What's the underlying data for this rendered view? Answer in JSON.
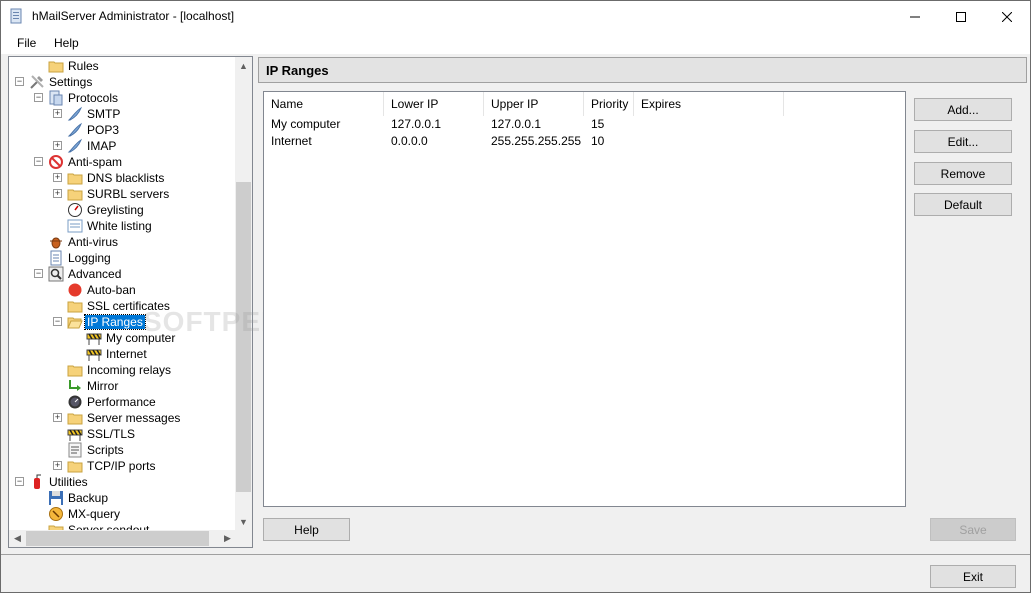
{
  "window": {
    "title": "hMailServer Administrator - [localhost]"
  },
  "menu": {
    "file": "File",
    "help": "Help"
  },
  "tree": {
    "nodes": [
      {
        "id": "rules",
        "label": "Rules",
        "icon": "folder-icon"
      },
      {
        "id": "settings",
        "label": "Settings",
        "icon": "tools-icon"
      },
      {
        "id": "protocols",
        "label": "Protocols",
        "icon": "protocols-icon"
      },
      {
        "id": "smtp",
        "label": "SMTP",
        "icon": "feather-icon"
      },
      {
        "id": "pop3",
        "label": "POP3",
        "icon": "feather-icon"
      },
      {
        "id": "imap",
        "label": "IMAP",
        "icon": "feather-icon"
      },
      {
        "id": "antispam",
        "label": "Anti-spam",
        "icon": "no-entry-icon"
      },
      {
        "id": "dns",
        "label": "DNS blacklists",
        "icon": "folder-icon"
      },
      {
        "id": "surbl",
        "label": "SURBL servers",
        "icon": "folder-icon"
      },
      {
        "id": "grey",
        "label": "Greylisting",
        "icon": "gauge-icon"
      },
      {
        "id": "white",
        "label": "White listing",
        "icon": "list-icon"
      },
      {
        "id": "antivirus",
        "label": "Anti-virus",
        "icon": "bug-icon"
      },
      {
        "id": "logging",
        "label": "Logging",
        "icon": "notepad-icon"
      },
      {
        "id": "advanced",
        "label": "Advanced",
        "icon": "magnifier-icon"
      },
      {
        "id": "autoban",
        "label": "Auto-ban",
        "icon": "stop-icon"
      },
      {
        "id": "ssl",
        "label": "SSL certificates",
        "icon": "folder-icon"
      },
      {
        "id": "ipranges",
        "label": "IP Ranges",
        "icon": "folder-open-icon"
      },
      {
        "id": "mycomputer",
        "label": "My computer",
        "icon": "barrier-icon"
      },
      {
        "id": "internet",
        "label": "Internet",
        "icon": "barrier-icon"
      },
      {
        "id": "incoming",
        "label": "Incoming relays",
        "icon": "folder-icon"
      },
      {
        "id": "mirror",
        "label": "Mirror",
        "icon": "arrows-icon"
      },
      {
        "id": "performance",
        "label": "Performance",
        "icon": "speedometer-icon"
      },
      {
        "id": "servermsg",
        "label": "Server messages",
        "icon": "folder-icon"
      },
      {
        "id": "ssltls",
        "label": "SSL/TLS",
        "icon": "barrier-icon"
      },
      {
        "id": "scripts",
        "label": "Scripts",
        "icon": "script-icon"
      },
      {
        "id": "tcpip",
        "label": "TCP/IP ports",
        "icon": "folder-icon"
      },
      {
        "id": "utilities",
        "label": "Utilities",
        "icon": "fire-extinguisher-icon"
      },
      {
        "id": "backup",
        "label": "Backup",
        "icon": "floppy-icon"
      },
      {
        "id": "mxquery",
        "label": "MX-query",
        "icon": "mx-icon"
      },
      {
        "id": "serversendout",
        "label": "Server sendout",
        "icon": "folder-icon"
      }
    ]
  },
  "panel": {
    "title": "IP Ranges"
  },
  "table": {
    "columns": [
      "Name",
      "Lower IP",
      "Upper IP",
      "Priority",
      "Expires"
    ],
    "rows": [
      [
        "My computer",
        "127.0.0.1",
        "127.0.0.1",
        "15",
        ""
      ],
      [
        "Internet",
        "0.0.0.0",
        "255.255.255.255",
        "10",
        ""
      ]
    ]
  },
  "buttons": {
    "add": "Add...",
    "edit": "Edit...",
    "remove": "Remove",
    "default": "Default",
    "help": "Help",
    "save": "Save",
    "exit": "Exit"
  },
  "watermark": "SOFTPEDIA"
}
